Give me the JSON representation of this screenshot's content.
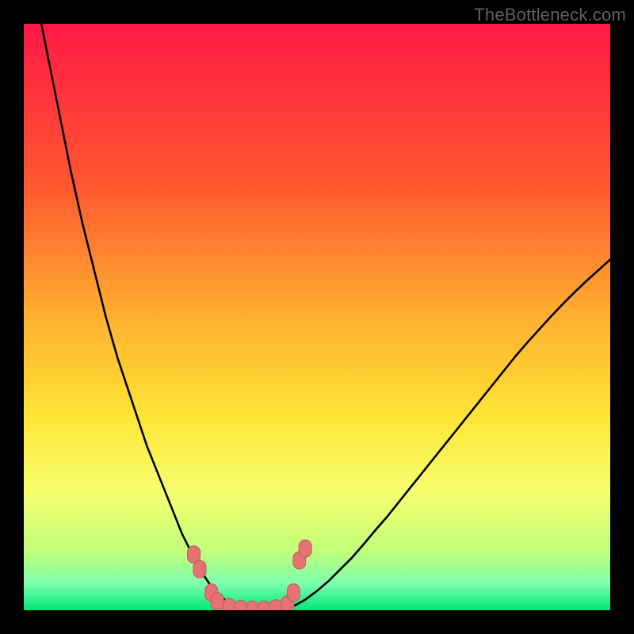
{
  "watermark": "TheBottleneck.com",
  "colors": {
    "page_bg": "#000000",
    "grad_top": "#ff1846",
    "grad_mid1": "#ff7a2a",
    "grad_mid2": "#ffe536",
    "grad_low1": "#f6ff70",
    "grad_low2": "#c0ff7a",
    "grad_bottom": "#00e676",
    "curve": "#000000",
    "marker_fill": "#e57373",
    "marker_stroke": "#c05a5a"
  },
  "chart_data": {
    "type": "line",
    "title": "",
    "xlabel": "",
    "ylabel": "",
    "xlim": [
      0,
      100
    ],
    "ylim": [
      0,
      100
    ],
    "x": [
      3,
      4,
      5,
      6,
      7,
      8,
      9,
      10,
      11,
      12,
      13,
      14,
      15,
      16,
      17,
      18,
      19,
      20,
      21,
      22,
      23,
      24,
      25,
      26,
      27,
      28,
      29,
      30,
      31,
      32,
      33,
      34,
      35,
      36,
      37,
      38,
      40,
      42,
      44,
      46,
      48,
      50,
      52,
      54,
      56,
      58,
      60,
      62,
      64,
      66,
      68,
      70,
      72,
      74,
      76,
      78,
      80,
      82,
      84,
      86,
      88,
      90,
      92,
      94,
      96,
      98,
      100
    ],
    "values": [
      100,
      95,
      90,
      85,
      80,
      75,
      70.5,
      66,
      62,
      58,
      54,
      50,
      46.5,
      43,
      40,
      37,
      34,
      31,
      28,
      25.5,
      23,
      20.5,
      18,
      15.5,
      13,
      11,
      9,
      7,
      5.5,
      4,
      3,
      2,
      1.3,
      0.8,
      0.4,
      0.15,
      0,
      0,
      0.1,
      0.7,
      1.8,
      3.3,
      5,
      7,
      9,
      11.3,
      13.7,
      16,
      18.5,
      21,
      23.5,
      26,
      28.5,
      31,
      33.5,
      36,
      38.5,
      41,
      43.5,
      45.8,
      48,
      50.2,
      52.3,
      54.3,
      56.2,
      58,
      59.8
    ],
    "markers": [
      {
        "x": 29,
        "y": 9.5
      },
      {
        "x": 30,
        "y": 7
      },
      {
        "x": 32,
        "y": 3
      },
      {
        "x": 33,
        "y": 1.5
      },
      {
        "x": 35,
        "y": 0.5
      },
      {
        "x": 37,
        "y": 0.2
      },
      {
        "x": 39,
        "y": 0.1
      },
      {
        "x": 41,
        "y": 0.1
      },
      {
        "x": 43,
        "y": 0.3
      },
      {
        "x": 45,
        "y": 1.0
      },
      {
        "x": 46,
        "y": 3.0
      },
      {
        "x": 47,
        "y": 8.5
      },
      {
        "x": 48,
        "y": 10.5
      }
    ]
  }
}
